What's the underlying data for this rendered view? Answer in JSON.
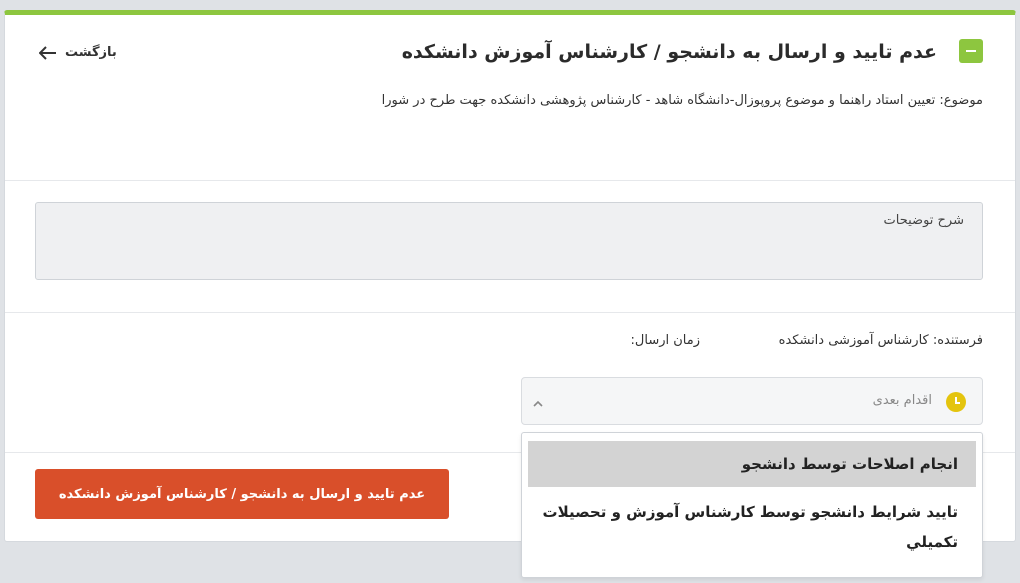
{
  "header": {
    "title": "عدم تایید و ارسال به دانشجو / کارشناس آموزش دانشکده",
    "back_label": "بازگشت",
    "subject": "موضوع: تعیین استاد راهنما و موضوع پروپوزال-دانشگاه شاهد - کارشناس پژوهشی دانشکده جهت طرح در شورا"
  },
  "notes": {
    "placeholder": "شرح توضیحات",
    "value": ""
  },
  "meta": {
    "sender": "فرستنده: کارشناس آموزشی دانشکده",
    "send_time": "زمان ارسال:"
  },
  "next_action": {
    "placeholder": "اقدام بعدی",
    "options": [
      "انجام اصلاحات توسط دانشجو",
      "تایید شرایط دانشجو توسط کارشناس آموزش و تحصیلات تکمیلي"
    ]
  },
  "submit_label": "عدم تایید و ارسال به دانشجو / کارشناس آموزش دانشکده",
  "colors": {
    "accent_green": "#8dc63f",
    "submit_red": "#d94f2a",
    "clock_yellow": "#e4c40e"
  },
  "icons": {
    "toggle": "collapse-icon",
    "back": "arrow-left-icon",
    "clock": "clock-icon",
    "chevron": "chevron-up-icon"
  }
}
